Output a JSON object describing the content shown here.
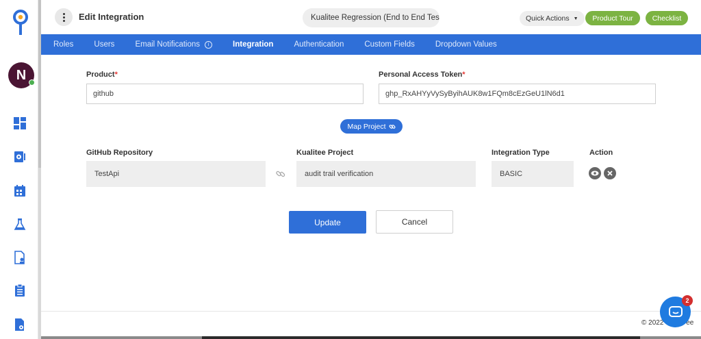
{
  "app": {
    "logo": "kualitee-logo",
    "avatar_initial": "N",
    "accent": "#2f6fd8",
    "green": "#7cb342"
  },
  "sidebar": {
    "icons": [
      "dashboard-icon",
      "settings-doc-icon",
      "calendar-icon",
      "flask-icon",
      "document-user-icon",
      "clipboard-icon",
      "document-gear-icon"
    ]
  },
  "header": {
    "title": "Edit Integration",
    "project": "Kualitee Regression (End to End Tes",
    "quick_actions": "Quick Actions",
    "product_tour": "Product Tour",
    "checklist": "Checklist"
  },
  "tabs": [
    {
      "label": "Roles"
    },
    {
      "label": "Users"
    },
    {
      "label": "Email Notifications"
    },
    {
      "label": "Integration"
    },
    {
      "label": "Authentication"
    },
    {
      "label": "Custom Fields"
    },
    {
      "label": "Dropdown Values"
    }
  ],
  "form": {
    "product_label": "Product",
    "product_value": "github",
    "token_label": "Personal Access Token",
    "token_value": "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",
    "map_project": "Map Project"
  },
  "mapping": {
    "headers": {
      "repo": "GitHub Repository",
      "project": "Kualitee Project",
      "type": "Integration Type",
      "action": "Action"
    },
    "row": {
      "repo": "TestApi",
      "project": "audit trail verification",
      "type": "BASIC"
    }
  },
  "actions": {
    "update": "Update",
    "cancel": "Cancel"
  },
  "footer": {
    "copyright": "© 2022",
    "trailing": "ee"
  },
  "chat": {
    "badge": "2"
  }
}
